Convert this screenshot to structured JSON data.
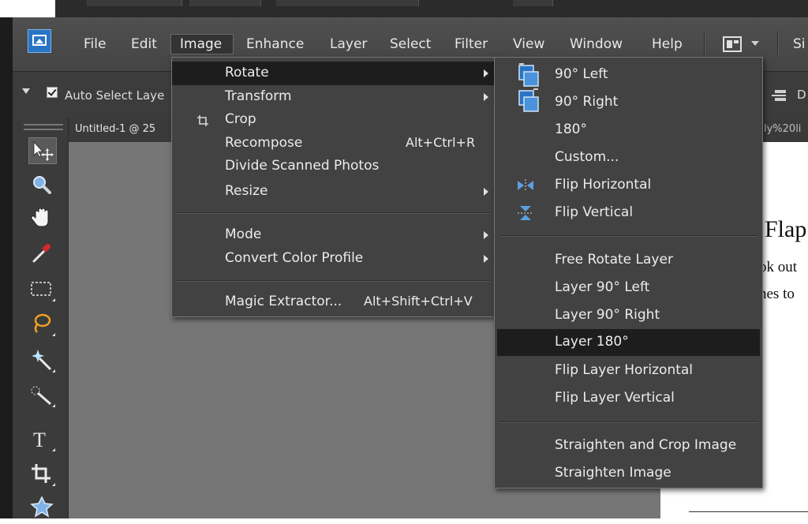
{
  "menubar": {
    "items": [
      "File",
      "Edit",
      "Image",
      "Enhance",
      "Layer",
      "Select",
      "Filter",
      "View",
      "Window",
      "Help"
    ],
    "right_clipped_text": "Si"
  },
  "options_bar": {
    "auto_select_label": "Auto Select Laye",
    "auto_select_checked": true,
    "right_clipped_text": "D"
  },
  "document": {
    "tab_label": "Untitled-1 @ 25",
    "tab2_label": "ly%20li",
    "text_heading_fragment": "Flap",
    "text_line1_fragment": "ok out",
    "text_line2_fragment": "nes to"
  },
  "image_menu": {
    "items": [
      {
        "label": "Rotate",
        "highlighted": true,
        "submenu": true
      },
      {
        "label": "Transform",
        "submenu": true
      },
      {
        "label": "Crop",
        "icon": "crop-icon"
      },
      {
        "label": "Recompose",
        "shortcut": "Alt+Ctrl+R"
      },
      {
        "label": "Divide Scanned Photos"
      },
      {
        "label": "Resize",
        "submenu": true
      },
      {
        "label": "Mode",
        "submenu": true
      },
      {
        "label": "Convert Color Profile",
        "submenu": true
      },
      {
        "label": "Magic Extractor...",
        "shortcut": "Alt+Shift+Ctrl+V"
      }
    ]
  },
  "rotate_menu": {
    "items": [
      {
        "label": "90° Left",
        "icon": "rotate-left-icon"
      },
      {
        "label": "90° Right",
        "icon": "rotate-right-icon"
      },
      {
        "label": "180°"
      },
      {
        "label": "Custom..."
      },
      {
        "label": "Flip Horizontal",
        "icon": "flip-horizontal-icon"
      },
      {
        "label": "Flip Vertical",
        "icon": "flip-vertical-icon"
      },
      {
        "label": "Free Rotate Layer"
      },
      {
        "label": "Layer 90° Left"
      },
      {
        "label": "Layer 90° Right"
      },
      {
        "label": "Layer 180°",
        "highlighted": true
      },
      {
        "label": "Flip Layer Horizontal"
      },
      {
        "label": "Flip Layer Vertical"
      },
      {
        "label": "Straighten and Crop Image"
      },
      {
        "label": "Straighten Image"
      }
    ]
  },
  "tools": [
    "move-tool-icon",
    "zoom-tool-icon",
    "hand-tool-icon",
    "eyedropper-tool-icon",
    "marquee-tool-icon",
    "lasso-tool-icon",
    "magic-wand-tool-icon",
    "quick-selection-tool-icon",
    "type-tool-icon",
    "crop-tool-icon",
    "cookie-cutter-tool-icon"
  ],
  "colors": {
    "menu_bg": "#424242",
    "highlight_bg": "#1d1d1d",
    "app_logo_blue": "#2a74c4",
    "canvas_gray": "#767676"
  }
}
